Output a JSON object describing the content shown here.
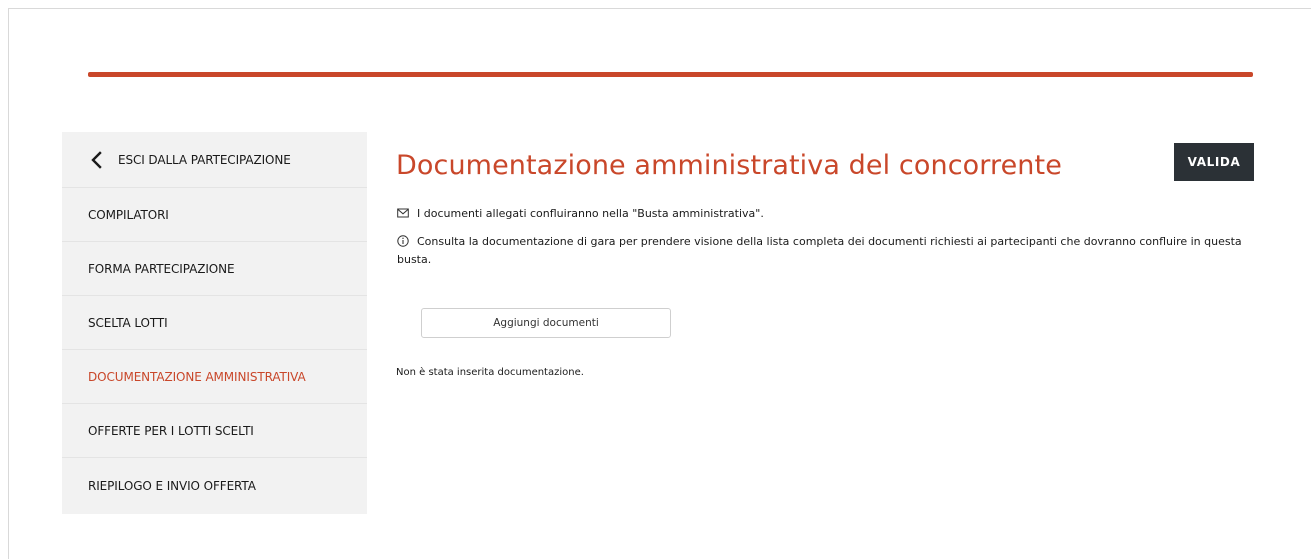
{
  "colors": {
    "accent": "#c9472a",
    "dark_button": "#2b3136",
    "sidebar_bg": "#f2f2f2"
  },
  "sidebar": {
    "back_label": "ESCI DALLA PARTECIPAZIONE",
    "back_icon": "chevron-left-icon",
    "items": [
      {
        "label": "COMPILATORI",
        "active": false
      },
      {
        "label": "FORMA PARTECIPAZIONE",
        "active": false
      },
      {
        "label": "SCELTA LOTTI",
        "active": false
      },
      {
        "label": "DOCUMENTAZIONE AMMINISTRATIVA",
        "active": true
      },
      {
        "label": "OFFERTE PER I LOTTI SCELTI",
        "active": false
      },
      {
        "label": "RIEPILOGO E INVIO OFFERTA",
        "active": false
      }
    ]
  },
  "main": {
    "title": "Documentazione amministrativa del concorrente",
    "valida_label": "VALIDA",
    "info_envelope_icon": "envelope-icon",
    "info_envelope_text": "I documenti allegati confluiranno nella \"Busta amministrativa\".",
    "info_circle_icon": "info-circle-icon",
    "info_circle_text": "Consulta la documentazione di gara per prendere visione della lista completa dei documenti richiesti ai partecipanti che dovranno confluire in questa busta.",
    "add_documents_label": "Aggiungi documenti",
    "empty_message": "Non è stata inserita documentazione."
  }
}
